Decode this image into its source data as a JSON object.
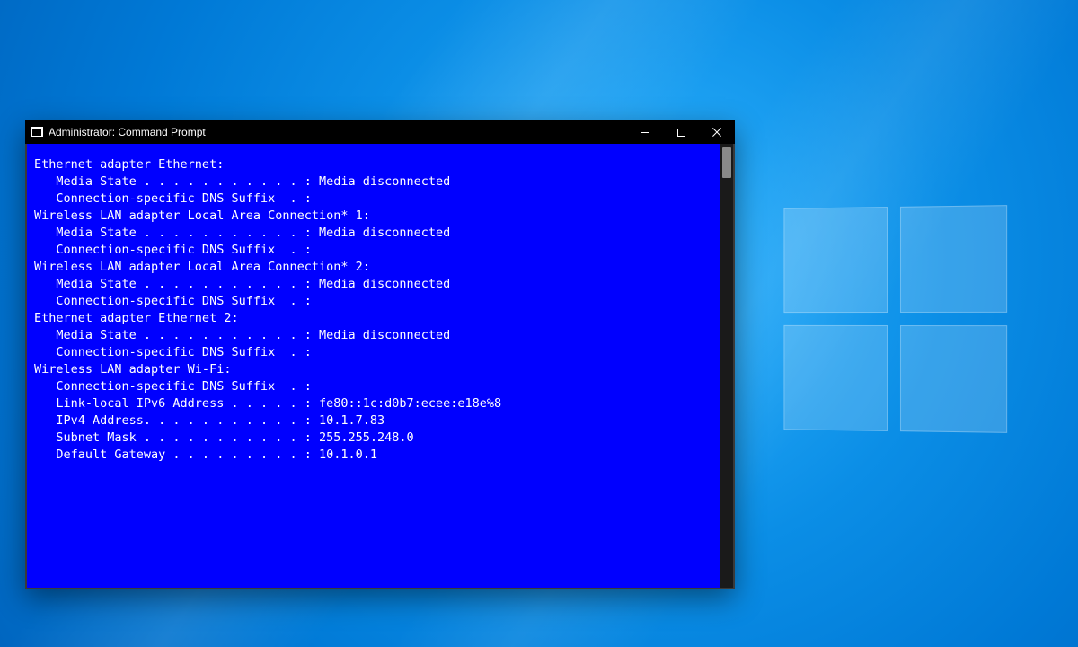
{
  "window": {
    "title": "Administrator: Command Prompt"
  },
  "terminal": {
    "lines": [
      "",
      "Ethernet adapter Ethernet:",
      "",
      "   Media State . . . . . . . . . . . : Media disconnected",
      "   Connection-specific DNS Suffix  . :",
      "",
      "Wireless LAN adapter Local Area Connection* 1:",
      "",
      "   Media State . . . . . . . . . . . : Media disconnected",
      "   Connection-specific DNS Suffix  . :",
      "",
      "Wireless LAN adapter Local Area Connection* 2:",
      "",
      "   Media State . . . . . . . . . . . : Media disconnected",
      "   Connection-specific DNS Suffix  . :",
      "",
      "Ethernet adapter Ethernet 2:",
      "",
      "   Media State . . . . . . . . . . . : Media disconnected",
      "   Connection-specific DNS Suffix  . :",
      "",
      "Wireless LAN adapter Wi-Fi:",
      "",
      "   Connection-specific DNS Suffix  . :",
      "   Link-local IPv6 Address . . . . . : fe80::1c:d0b7:ecee:e18e%8",
      "   IPv4 Address. . . . . . . . . . . : 10.1.7.83",
      "   Subnet Mask . . . . . . . . . . . : 255.255.248.0",
      "   Default Gateway . . . . . . . . . : 10.1.0.1"
    ]
  }
}
